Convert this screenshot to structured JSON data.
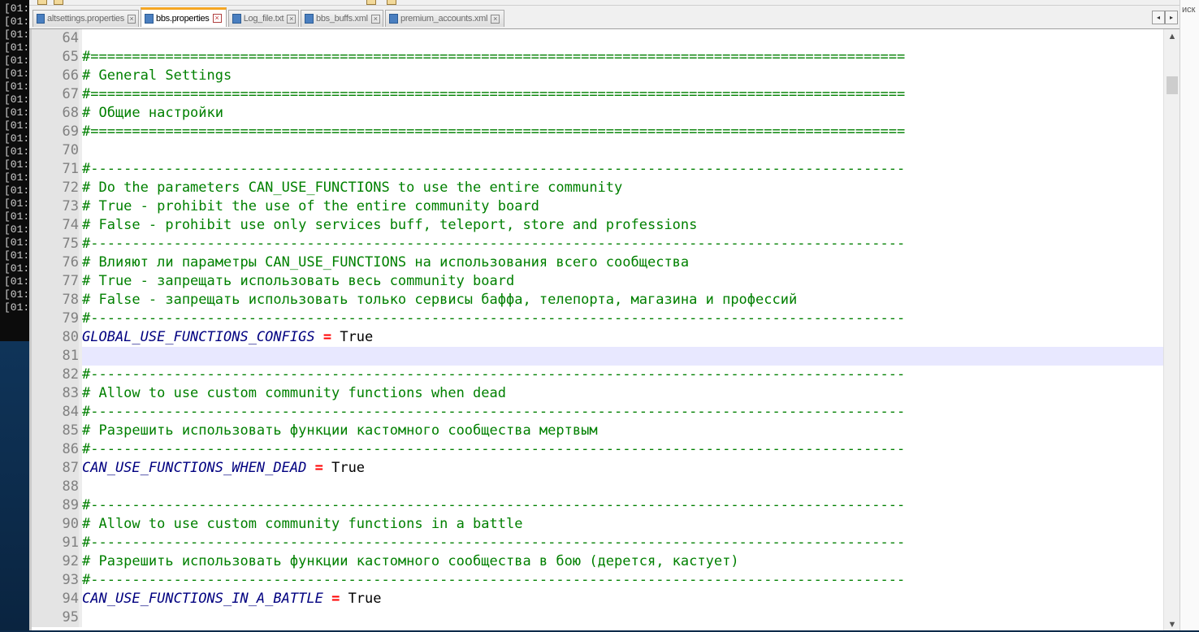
{
  "console": {
    "lines": [
      "[01:",
      "[01:",
      "[01:",
      "[01:",
      "[01:",
      "[01:",
      "[01:",
      "[01:",
      "[01:",
      "[01:",
      "[01:",
      "[01:",
      "[01:",
      "[01:",
      "[01:",
      "[01:",
      "[01:",
      "[01:",
      "[01:",
      "[01:",
      "[01:",
      "[01:",
      "[01:",
      "[01:"
    ]
  },
  "tabs": [
    {
      "label": "altsettings.properties",
      "active": false
    },
    {
      "label": "bbs.properties",
      "active": true
    },
    {
      "label": "Log_file.txt",
      "active": false
    },
    {
      "label": "bbs_buffs.xml",
      "active": false
    },
    {
      "label": "premium_accounts.xml",
      "active": false
    }
  ],
  "tab_nav": {
    "prev": "◂",
    "next": "▸"
  },
  "right_strip_text": "иск",
  "scroll": {
    "up": "▲",
    "down": "▼"
  },
  "current_line": 81,
  "lines": [
    {
      "n": 64,
      "t": ""
    },
    {
      "n": 65,
      "t": "#==================================================================================================",
      "k": "cm"
    },
    {
      "n": 66,
      "t": "# General Settings",
      "k": "cm"
    },
    {
      "n": 67,
      "t": "#==================================================================================================",
      "k": "cm"
    },
    {
      "n": 68,
      "t": "# Общие настройки",
      "k": "cm"
    },
    {
      "n": 69,
      "t": "#==================================================================================================",
      "k": "cm"
    },
    {
      "n": 70,
      "t": ""
    },
    {
      "n": 71,
      "t": "#--------------------------------------------------------------------------------------------------",
      "k": "cm"
    },
    {
      "n": 72,
      "t": "# Do the parameters CAN_USE_FUNCTIONS to use the entire community",
      "k": "cm"
    },
    {
      "n": 73,
      "t": "# True - prohibit the use of the entire community board",
      "k": "cm"
    },
    {
      "n": 74,
      "t": "# False - prohibit use only services buff, teleport, store and professions",
      "k": "cm"
    },
    {
      "n": 75,
      "t": "#--------------------------------------------------------------------------------------------------",
      "k": "cm"
    },
    {
      "n": 76,
      "t": "# Влияют ли параметры CAN_USE_FUNCTIONS на использования всего сообщества",
      "k": "cm"
    },
    {
      "n": 77,
      "t": "# True - запрещать использовать весь community board",
      "k": "cm"
    },
    {
      "n": 78,
      "t": "# False - запрещать использовать только сервисы баффа, телепорта, магазина и профессий",
      "k": "cm"
    },
    {
      "n": 79,
      "t": "#--------------------------------------------------------------------------------------------------",
      "k": "cm"
    },
    {
      "n": 80,
      "key": "GLOBAL_USE_FUNCTIONS_CONFIGS",
      "eq": "=",
      "val": "True"
    },
    {
      "n": 81,
      "t": ""
    },
    {
      "n": 82,
      "t": "#--------------------------------------------------------------------------------------------------",
      "k": "cm"
    },
    {
      "n": 83,
      "t": "# Allow to use custom community functions when dead",
      "k": "cm"
    },
    {
      "n": 84,
      "t": "#--------------------------------------------------------------------------------------------------",
      "k": "cm"
    },
    {
      "n": 85,
      "t": "# Разрешить использовать функции кастомного сообщества мертвым",
      "k": "cm"
    },
    {
      "n": 86,
      "t": "#--------------------------------------------------------------------------------------------------",
      "k": "cm"
    },
    {
      "n": 87,
      "key": "CAN_USE_FUNCTIONS_WHEN_DEAD",
      "eq": "=",
      "val": "True"
    },
    {
      "n": 88,
      "t": ""
    },
    {
      "n": 89,
      "t": "#--------------------------------------------------------------------------------------------------",
      "k": "cm"
    },
    {
      "n": 90,
      "t": "# Allow to use custom community functions in a battle",
      "k": "cm"
    },
    {
      "n": 91,
      "t": "#--------------------------------------------------------------------------------------------------",
      "k": "cm"
    },
    {
      "n": 92,
      "t": "# Разрешить использовать функции кастомного сообщества в бою (дерется, кастует)",
      "k": "cm"
    },
    {
      "n": 93,
      "t": "#--------------------------------------------------------------------------------------------------",
      "k": "cm"
    },
    {
      "n": 94,
      "key": "CAN_USE_FUNCTIONS_IN_A_BATTLE",
      "eq": "=",
      "val": "True"
    },
    {
      "n": 95,
      "t": ""
    }
  ]
}
